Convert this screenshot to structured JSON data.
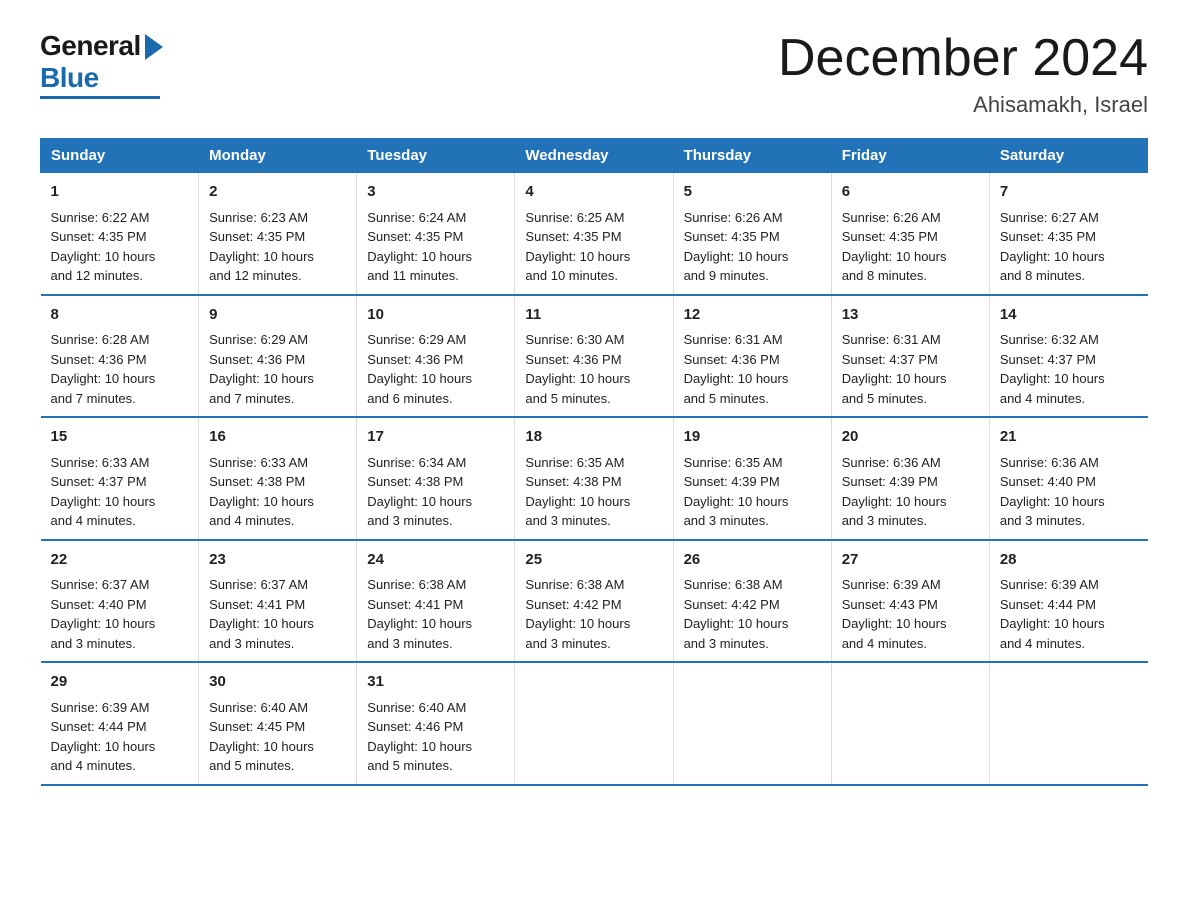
{
  "logo": {
    "general": "General",
    "blue": "Blue"
  },
  "title": "December 2024",
  "subtitle": "Ahisamakh, Israel",
  "headers": [
    "Sunday",
    "Monday",
    "Tuesday",
    "Wednesday",
    "Thursday",
    "Friday",
    "Saturday"
  ],
  "weeks": [
    [
      {
        "day": "1",
        "info": "Sunrise: 6:22 AM\nSunset: 4:35 PM\nDaylight: 10 hours\nand 12 minutes."
      },
      {
        "day": "2",
        "info": "Sunrise: 6:23 AM\nSunset: 4:35 PM\nDaylight: 10 hours\nand 12 minutes."
      },
      {
        "day": "3",
        "info": "Sunrise: 6:24 AM\nSunset: 4:35 PM\nDaylight: 10 hours\nand 11 minutes."
      },
      {
        "day": "4",
        "info": "Sunrise: 6:25 AM\nSunset: 4:35 PM\nDaylight: 10 hours\nand 10 minutes."
      },
      {
        "day": "5",
        "info": "Sunrise: 6:26 AM\nSunset: 4:35 PM\nDaylight: 10 hours\nand 9 minutes."
      },
      {
        "day": "6",
        "info": "Sunrise: 6:26 AM\nSunset: 4:35 PM\nDaylight: 10 hours\nand 8 minutes."
      },
      {
        "day": "7",
        "info": "Sunrise: 6:27 AM\nSunset: 4:35 PM\nDaylight: 10 hours\nand 8 minutes."
      }
    ],
    [
      {
        "day": "8",
        "info": "Sunrise: 6:28 AM\nSunset: 4:36 PM\nDaylight: 10 hours\nand 7 minutes."
      },
      {
        "day": "9",
        "info": "Sunrise: 6:29 AM\nSunset: 4:36 PM\nDaylight: 10 hours\nand 7 minutes."
      },
      {
        "day": "10",
        "info": "Sunrise: 6:29 AM\nSunset: 4:36 PM\nDaylight: 10 hours\nand 6 minutes."
      },
      {
        "day": "11",
        "info": "Sunrise: 6:30 AM\nSunset: 4:36 PM\nDaylight: 10 hours\nand 5 minutes."
      },
      {
        "day": "12",
        "info": "Sunrise: 6:31 AM\nSunset: 4:36 PM\nDaylight: 10 hours\nand 5 minutes."
      },
      {
        "day": "13",
        "info": "Sunrise: 6:31 AM\nSunset: 4:37 PM\nDaylight: 10 hours\nand 5 minutes."
      },
      {
        "day": "14",
        "info": "Sunrise: 6:32 AM\nSunset: 4:37 PM\nDaylight: 10 hours\nand 4 minutes."
      }
    ],
    [
      {
        "day": "15",
        "info": "Sunrise: 6:33 AM\nSunset: 4:37 PM\nDaylight: 10 hours\nand 4 minutes."
      },
      {
        "day": "16",
        "info": "Sunrise: 6:33 AM\nSunset: 4:38 PM\nDaylight: 10 hours\nand 4 minutes."
      },
      {
        "day": "17",
        "info": "Sunrise: 6:34 AM\nSunset: 4:38 PM\nDaylight: 10 hours\nand 3 minutes."
      },
      {
        "day": "18",
        "info": "Sunrise: 6:35 AM\nSunset: 4:38 PM\nDaylight: 10 hours\nand 3 minutes."
      },
      {
        "day": "19",
        "info": "Sunrise: 6:35 AM\nSunset: 4:39 PM\nDaylight: 10 hours\nand 3 minutes."
      },
      {
        "day": "20",
        "info": "Sunrise: 6:36 AM\nSunset: 4:39 PM\nDaylight: 10 hours\nand 3 minutes."
      },
      {
        "day": "21",
        "info": "Sunrise: 6:36 AM\nSunset: 4:40 PM\nDaylight: 10 hours\nand 3 minutes."
      }
    ],
    [
      {
        "day": "22",
        "info": "Sunrise: 6:37 AM\nSunset: 4:40 PM\nDaylight: 10 hours\nand 3 minutes."
      },
      {
        "day": "23",
        "info": "Sunrise: 6:37 AM\nSunset: 4:41 PM\nDaylight: 10 hours\nand 3 minutes."
      },
      {
        "day": "24",
        "info": "Sunrise: 6:38 AM\nSunset: 4:41 PM\nDaylight: 10 hours\nand 3 minutes."
      },
      {
        "day": "25",
        "info": "Sunrise: 6:38 AM\nSunset: 4:42 PM\nDaylight: 10 hours\nand 3 minutes."
      },
      {
        "day": "26",
        "info": "Sunrise: 6:38 AM\nSunset: 4:42 PM\nDaylight: 10 hours\nand 3 minutes."
      },
      {
        "day": "27",
        "info": "Sunrise: 6:39 AM\nSunset: 4:43 PM\nDaylight: 10 hours\nand 4 minutes."
      },
      {
        "day": "28",
        "info": "Sunrise: 6:39 AM\nSunset: 4:44 PM\nDaylight: 10 hours\nand 4 minutes."
      }
    ],
    [
      {
        "day": "29",
        "info": "Sunrise: 6:39 AM\nSunset: 4:44 PM\nDaylight: 10 hours\nand 4 minutes."
      },
      {
        "day": "30",
        "info": "Sunrise: 6:40 AM\nSunset: 4:45 PM\nDaylight: 10 hours\nand 5 minutes."
      },
      {
        "day": "31",
        "info": "Sunrise: 6:40 AM\nSunset: 4:46 PM\nDaylight: 10 hours\nand 5 minutes."
      },
      {
        "day": "",
        "info": ""
      },
      {
        "day": "",
        "info": ""
      },
      {
        "day": "",
        "info": ""
      },
      {
        "day": "",
        "info": ""
      }
    ]
  ]
}
